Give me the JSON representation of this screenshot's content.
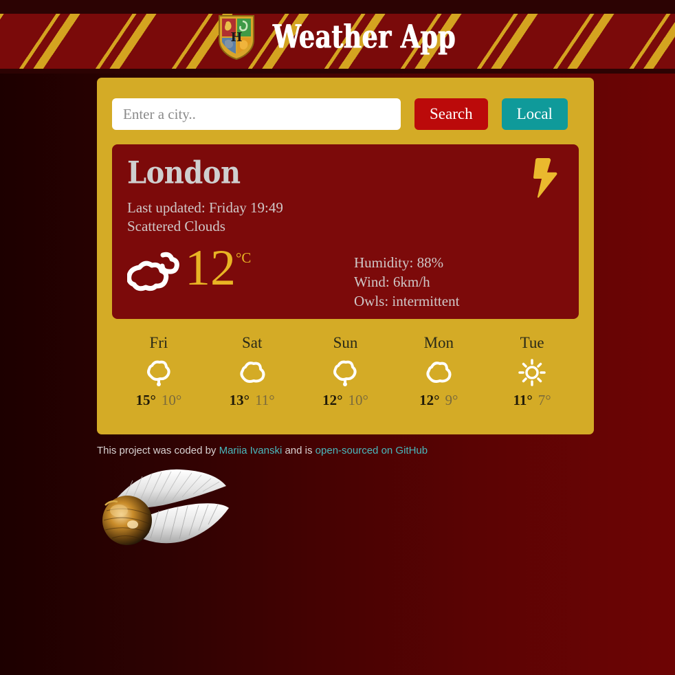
{
  "header": {
    "title": "Weather App",
    "logo_icon": "hogwarts-crest-icon",
    "bg_color": "#7a0a0a",
    "stripe_color": "#d4a420"
  },
  "search": {
    "placeholder": "Enter a city..",
    "value": "",
    "search_label": "Search",
    "local_label": "Local",
    "search_color": "#bb0a0a",
    "local_color": "#0f9a9a"
  },
  "panel": {
    "bg_color": "#d4ab26"
  },
  "current": {
    "city": "London",
    "last_updated": "Last updated: Friday 19:49",
    "description": "Scattered Clouds",
    "temperature": "12",
    "unit": "°C",
    "temp_color": "#e8b424",
    "condition_icon": "scattered-clouds-icon",
    "corner_icon": "lightning-bolt-icon",
    "humidity": "Humidity: 88%",
    "wind": "Wind: 6km/h",
    "owls": "Owls: intermittent",
    "card_color": "#7c0a0a"
  },
  "forecast": [
    {
      "day": "Fri",
      "icon": "rain-cloud-icon",
      "max": "15°",
      "min": "10°"
    },
    {
      "day": "Sat",
      "icon": "cloud-icon",
      "max": "13°",
      "min": "11°"
    },
    {
      "day": "Sun",
      "icon": "rain-cloud-icon",
      "max": "12°",
      "min": "10°"
    },
    {
      "day": "Mon",
      "icon": "cloud-icon",
      "max": "12°",
      "min": "9°"
    },
    {
      "day": "Tue",
      "icon": "sun-icon",
      "max": "11°",
      "min": "7°"
    }
  ],
  "footer": {
    "text_before": "This project was coded by ",
    "author": "Mariia Ivanski",
    "text_middle": " and is ",
    "source_link": "open-sourced on GitHub",
    "link_color": "#49b8bd",
    "snitch_icon": "golden-snitch-icon"
  }
}
